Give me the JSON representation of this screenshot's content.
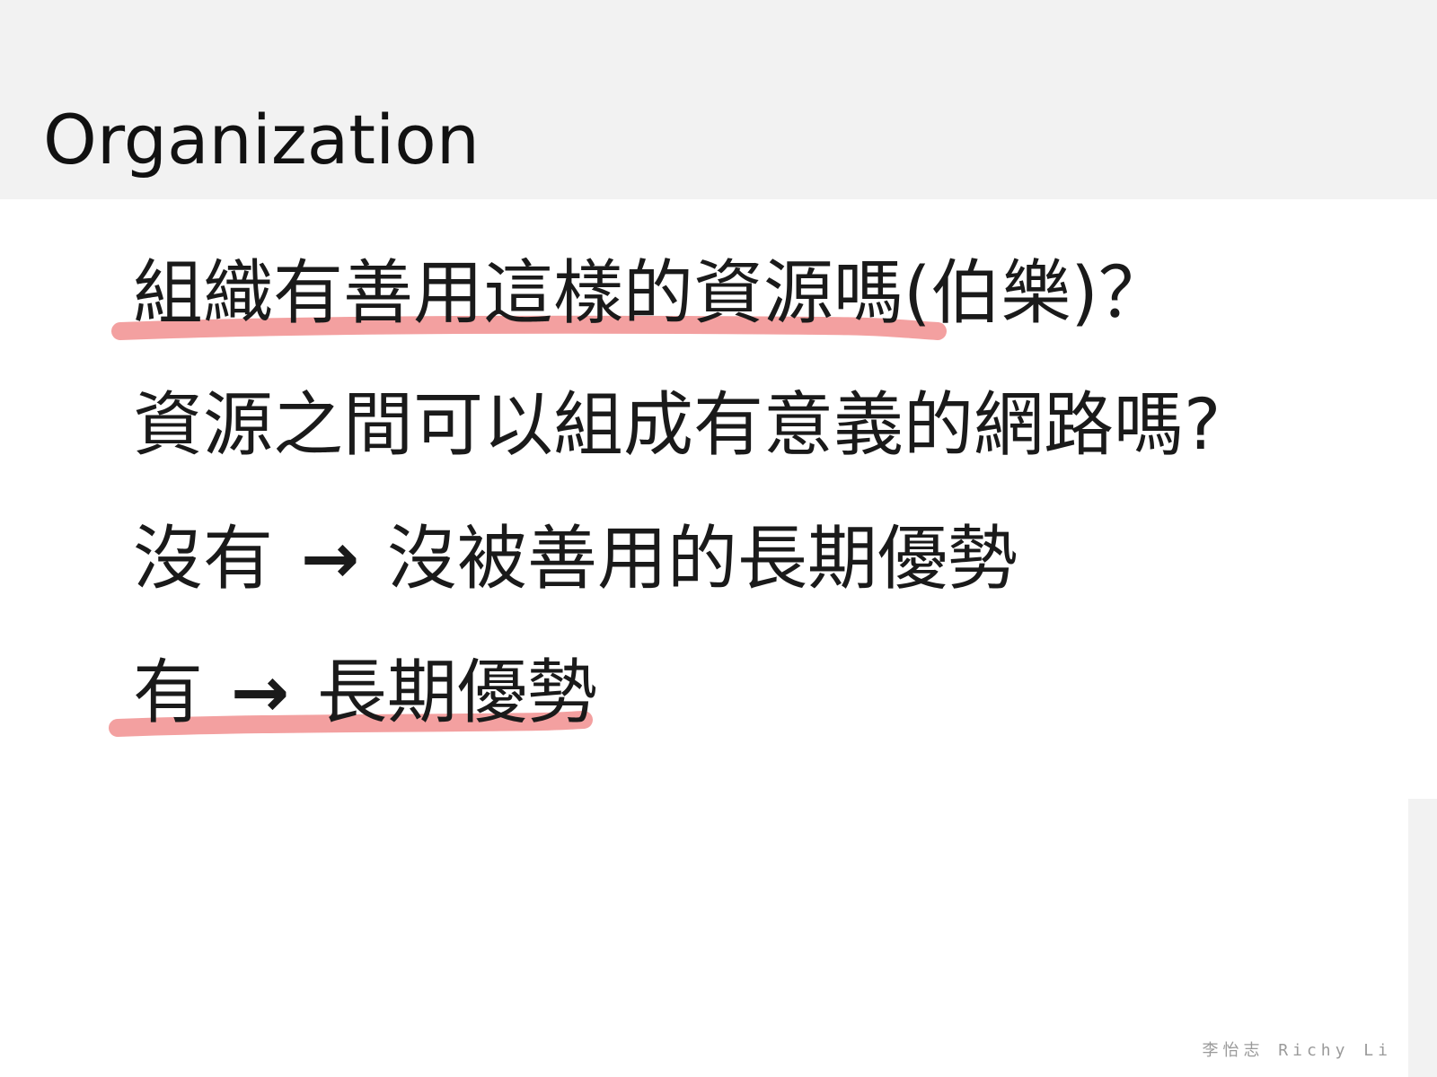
{
  "slide": {
    "title": "Organization",
    "lines": [
      {
        "text": "組織有善用這樣的資源嗎(伯樂)？"
      },
      {
        "text": "資源之間可以組成有意義的網路嗎?"
      },
      {
        "left": "沒有",
        "arrow": "→",
        "right": "沒被善用的長期優勢"
      },
      {
        "left": "有",
        "arrow": "→",
        "right": "長期優勢"
      }
    ],
    "footer": "李怡志 Richy Li"
  },
  "colors": {
    "header_band": "#f2f2f2",
    "highlight": "#f08b8b",
    "text": "#1a1a1a",
    "footer": "#9a9a9a"
  }
}
